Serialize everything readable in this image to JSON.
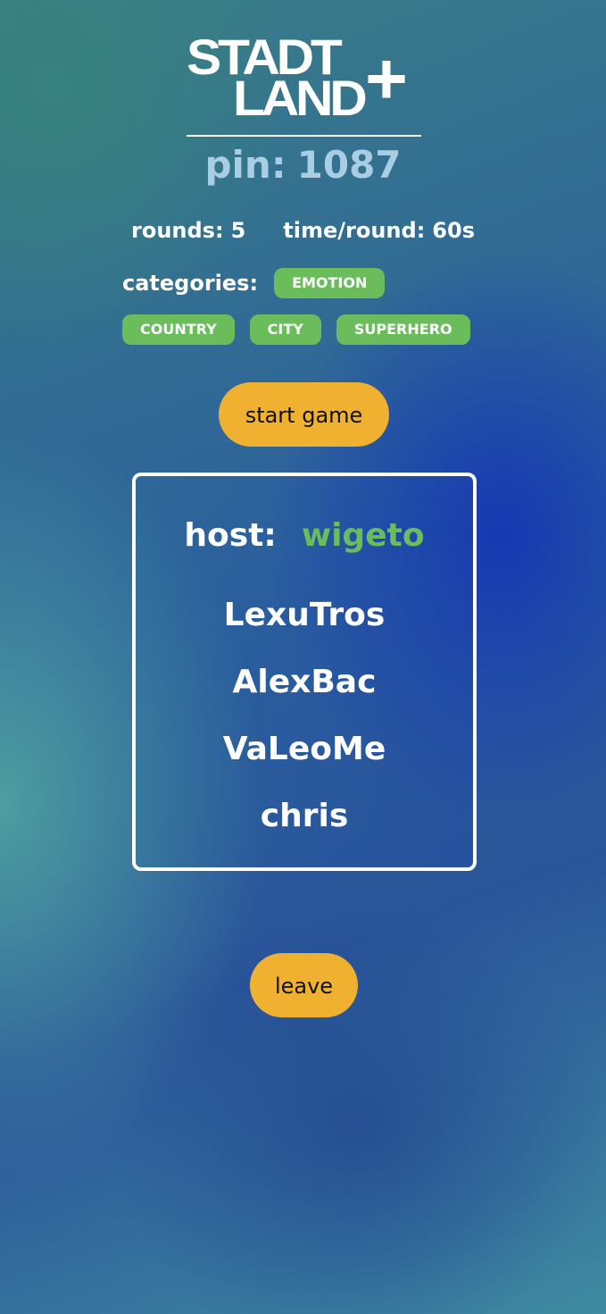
{
  "logo": {
    "line1": "STADT",
    "line2": "LAND",
    "plus": "+"
  },
  "pin": {
    "label": "pin:",
    "value": "1087"
  },
  "settings": {
    "rounds_label": "rounds:",
    "rounds_value": "5",
    "time_label": "time/round:",
    "time_value": "60s"
  },
  "categories": {
    "label": "categories:",
    "items": [
      "EMOTION",
      "COUNTRY",
      "CITY",
      "SUPERHERO"
    ]
  },
  "buttons": {
    "start_label": "start game",
    "leave_label": "leave"
  },
  "lobby": {
    "host_label": "host:",
    "host_name": "wigeto",
    "players": [
      "LexuTros",
      "AlexBac",
      "VaLeoMe",
      "chris"
    ]
  },
  "colors": {
    "accent_button": "#f0b131",
    "chip_green": "#6bbd5c",
    "pin_blue": "#a9cde3"
  }
}
